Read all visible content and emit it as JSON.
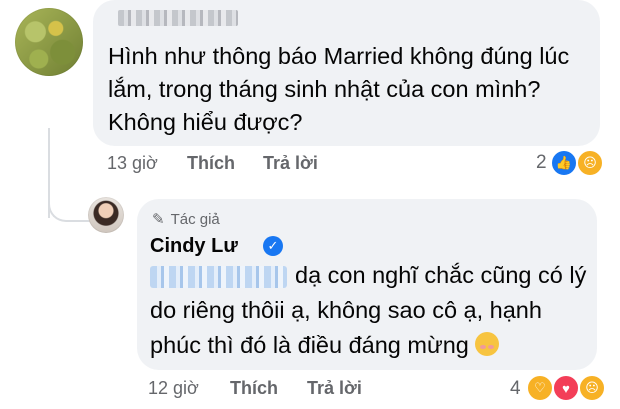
{
  "comment1": {
    "author_name_hidden": true,
    "text": "Hình như thông báo Married không đúng lúc lắm, trong tháng sinh nhật của con mình? Không hiểu được?",
    "time": "13 giờ",
    "like_label": "Thích",
    "reply_label": "Trả lời",
    "reaction_count": "2",
    "reactions": [
      "like-icon",
      "sad-icon"
    ]
  },
  "comment2": {
    "author_badge": "Tác giả",
    "author_name": "Cindy Lư",
    "verified": true,
    "mention_hidden": true,
    "text": "dạ con nghĩ chắc cũng có lý do riêng thôii ạ, không sao cô ạ, hạnh phúc thì đó là điều đáng mừng",
    "time": "12 giờ",
    "like_label": "Thích",
    "reply_label": "Trả lời",
    "reaction_count": "4",
    "reactions": [
      "care-icon",
      "love-icon",
      "sad-icon"
    ]
  },
  "colors": {
    "bubble": "#f0f2f5",
    "meta_text": "#65676b",
    "like_blue": "#1877f2",
    "love_red": "#f33e58",
    "emoji_yellow": "#f7b125"
  }
}
